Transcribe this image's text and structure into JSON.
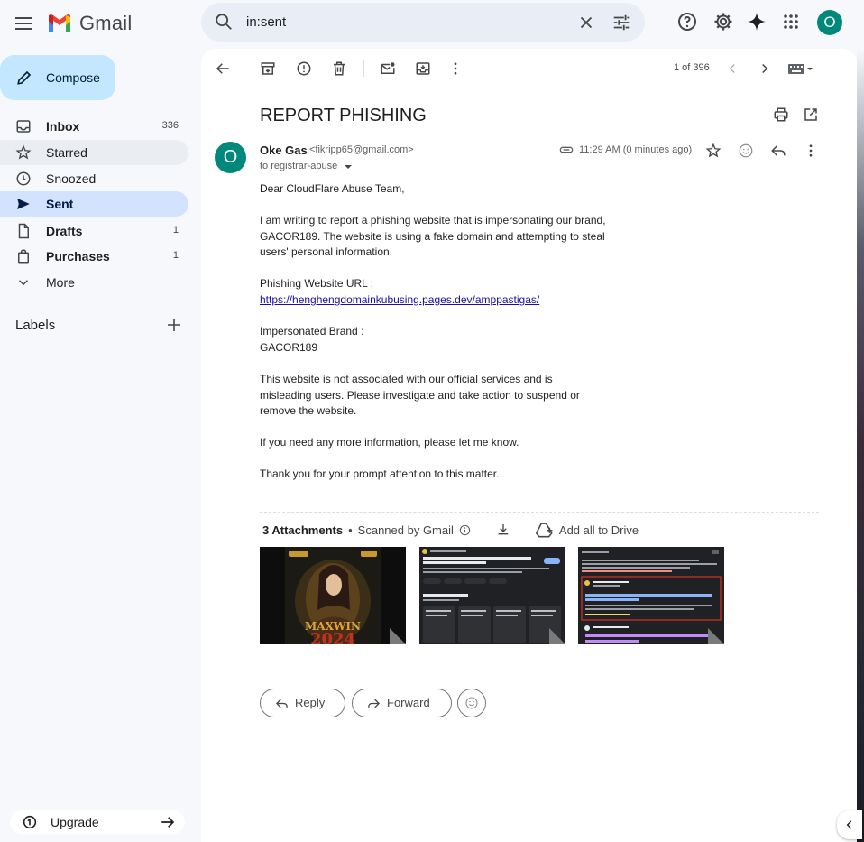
{
  "app": {
    "logo_text": "Gmail",
    "accent": "#c2e7ff",
    "avatar_color": "#00897b"
  },
  "search": {
    "query": "in:sent"
  },
  "account": {
    "initial": "O"
  },
  "compose": {
    "label": "Compose"
  },
  "nav": {
    "items": [
      {
        "label": "Inbox",
        "count": "336",
        "icon": "inbox-icon"
      },
      {
        "label": "Starred",
        "count": "",
        "icon": "star-icon"
      },
      {
        "label": "Snoozed",
        "count": "",
        "icon": "clock-icon"
      },
      {
        "label": "Sent",
        "count": "",
        "icon": "send-icon"
      },
      {
        "label": "Drafts",
        "count": "1",
        "icon": "draft-icon"
      },
      {
        "label": "Purchases",
        "count": "1",
        "icon": "bag-icon"
      },
      {
        "label": "More",
        "count": "",
        "icon": "chevron-down-icon"
      }
    ]
  },
  "labels": {
    "heading": "Labels"
  },
  "upgrade": {
    "label": "Upgrade"
  },
  "pager": {
    "text": "1 of 396"
  },
  "email": {
    "subject": "REPORT PHISHING",
    "sender_initial": "O",
    "sender_name": "Oke Gas",
    "sender_email": "<fikripp65@gmail.com>",
    "to": "to registrar-abuse",
    "time": "11:29 AM (0 minutes ago)",
    "greeting": "Dear CloudFlare Abuse Team,",
    "p1": "I am writing to report a phishing website that is impersonating our brand, GACOR189. The website is using a fake domain and attempting to steal users' personal information.",
    "url_label": "Phishing Website URL :",
    "url": "https://henghengdomainkubusing.pages.dev/amppastigas/",
    "brand_label": "Impersonated Brand :",
    "brand": "GACOR189",
    "p2": "This website is not associated with our official services and is misleading users. Please investigate and take action to suspend or remove the website.",
    "p3": "If you need any more information, please let me know.",
    "p4": "Thank you for your prompt attention to this matter."
  },
  "attachments": {
    "count_label": "3 Attachments",
    "scanned": "Scanned by Gmail",
    "add_drive": "Add all to Drive"
  },
  "actions": {
    "reply": "Reply",
    "forward": "Forward"
  }
}
